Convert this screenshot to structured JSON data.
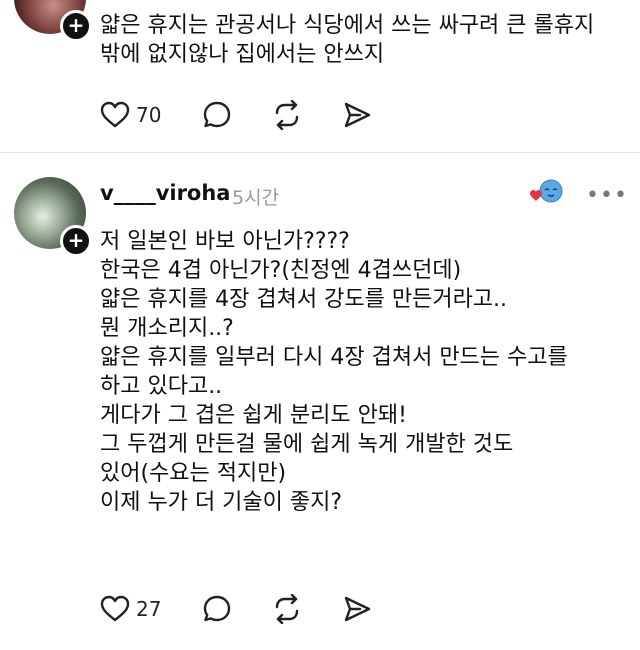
{
  "posts": [
    {
      "lines": [
        "얇은 휴지는 관공서나 식당에서 쓰는 싸구려 큰 롤휴지",
        "밖에 없지않나 집에서는 안쓰지"
      ],
      "likes": "70"
    },
    {
      "username": "v____viroha",
      "time": "5시간",
      "lines": [
        "저 일본인 바보 아닌가????",
        "한국은 4겹 아닌가?(친정엔 4겹쓰던데)",
        "얇은 휴지를 4장 겹쳐서 강도를 만든거라고..",
        "뭔 개소리지..?",
        "얇은 휴지를 일부러 다시 4장 겹쳐서 만드는 수고를",
        "하고 있다고..",
        "게다가 그 겹은 쉽게 분리도 안돼!",
        "그 두껍게 만든걸 물에 쉽게 녹게 개발한 것도",
        "있어(수요는 적지만)",
        "이제 누가 더 기술이 좋지?"
      ],
      "likes": "27"
    }
  ],
  "ui": {
    "plus_symbol": "+",
    "more_symbol": "•••",
    "icon_color": "#222222",
    "divider_color": "#e6e6e6",
    "time_color": "#9a9a9a",
    "icons": [
      "heart-icon",
      "comment-icon",
      "repost-icon",
      "share-icon",
      "avatar-emoji-icon"
    ]
  }
}
